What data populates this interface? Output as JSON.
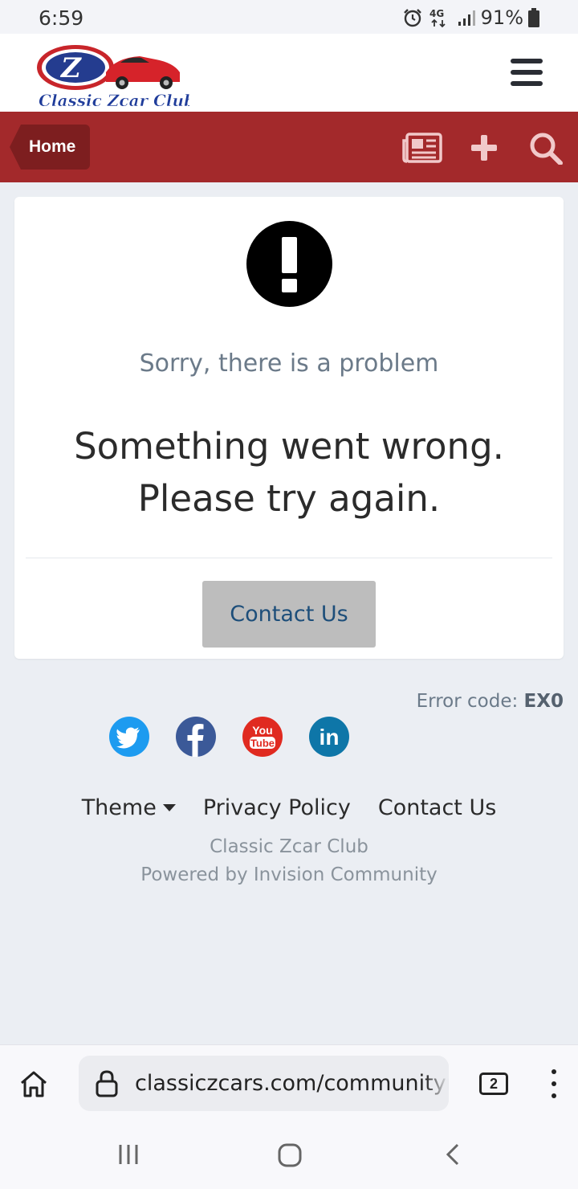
{
  "status_bar": {
    "time": "6:59",
    "network": "4G",
    "battery": "91%"
  },
  "header": {
    "logo_text": "Classic Zcar Club",
    "logo_letter": "Z",
    "menu_icon": "hamburger-menu-icon"
  },
  "navbar": {
    "home_label": "Home",
    "icons": [
      "newspaper-icon",
      "plus-icon",
      "search-icon"
    ]
  },
  "error": {
    "subtitle": "Sorry, there is a problem",
    "message_line1": "Something went wrong.",
    "message_line2": "Please try again.",
    "button_label": "Contact Us",
    "code_label": "Error code:",
    "code_value": "EX0"
  },
  "socials": [
    "twitter",
    "facebook",
    "youtube",
    "linkedin"
  ],
  "social_youtube_lines": [
    "You",
    "Tube"
  ],
  "social_linkedin_text": "in",
  "footer": {
    "links": {
      "theme": "Theme",
      "privacy": "Privacy Policy",
      "contact": "Contact Us"
    },
    "site_name": "Classic Zcar Club",
    "powered_by": "Powered by Invision Community"
  },
  "browser": {
    "url": "classiczcars.com/communitym",
    "tab_count": "2"
  },
  "colors": {
    "navbar": "#a3292b",
    "crumb": "#7d1e1f",
    "button": "#bdbdbd",
    "button_text": "#1d4e7a",
    "page_bg": "#ebeef3"
  }
}
